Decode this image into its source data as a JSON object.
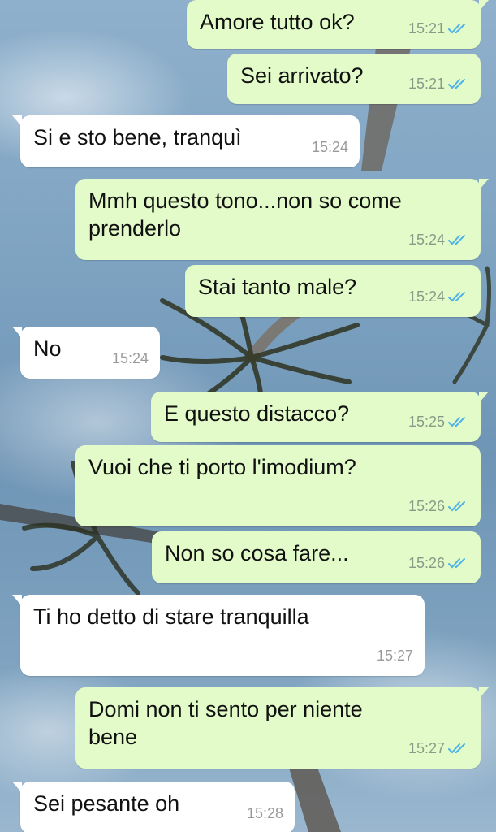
{
  "chat": {
    "background_description": "palm-tree-sky-wallpaper",
    "colors": {
      "outgoing_bubble": "#e2fbc8",
      "incoming_bubble": "#ffffff",
      "read_ticks": "#4fb3e8"
    },
    "messages": [
      {
        "dir": "out",
        "text": "Amore tutto ok?",
        "time": "15:21",
        "status_icon": "double-check-read-icon"
      },
      {
        "dir": "out",
        "text": "Sei arrivato?",
        "time": "15:21",
        "status_icon": "double-check-read-icon"
      },
      {
        "dir": "in",
        "text": "Si e sto bene, tranquì",
        "time": "15:24"
      },
      {
        "dir": "out",
        "text": "Mmh questo tono...non so come\nprenderlo",
        "time": "15:24",
        "status_icon": "double-check-read-icon"
      },
      {
        "dir": "out",
        "text": "Stai tanto male?",
        "time": "15:24",
        "status_icon": "double-check-read-icon"
      },
      {
        "dir": "in",
        "text": "No",
        "time": "15:24"
      },
      {
        "dir": "out",
        "text": "E questo distacco?",
        "time": "15:25",
        "status_icon": "double-check-read-icon"
      },
      {
        "dir": "out",
        "text": "Vuoi che ti porto l'imodium?",
        "time": "15:26",
        "status_icon": "double-check-read-icon"
      },
      {
        "dir": "out",
        "text": "Non so cosa fare...",
        "time": "15:26",
        "status_icon": "double-check-read-icon"
      },
      {
        "dir": "in",
        "text": "Ti ho detto di stare tranquilla",
        "time": "15:27"
      },
      {
        "dir": "out",
        "text": "Domi non ti sento per niente\nbene",
        "time": "15:27",
        "status_icon": "double-check-read-icon"
      },
      {
        "dir": "in",
        "text": "Sei pesante oh",
        "time": "15:28"
      }
    ]
  }
}
